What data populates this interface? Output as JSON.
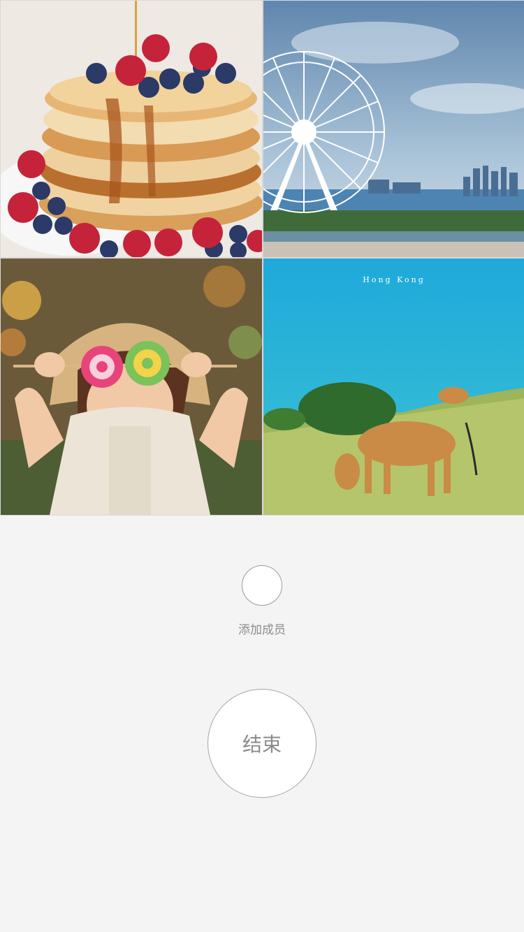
{
  "tiles": [
    {
      "name": "pancakes-photo"
    },
    {
      "name": "ferris-wheel-photo"
    },
    {
      "name": "girl-lollipops-photo"
    },
    {
      "name": "cows-seaside-photo",
      "caption": "Hong Kong"
    }
  ],
  "add_member": {
    "label": "添加成员"
  },
  "end_button": {
    "label": "结束"
  },
  "colors": {
    "background": "#f4f4f4",
    "circle_border": "#9a9a9a",
    "text": "#8d8d8d"
  }
}
